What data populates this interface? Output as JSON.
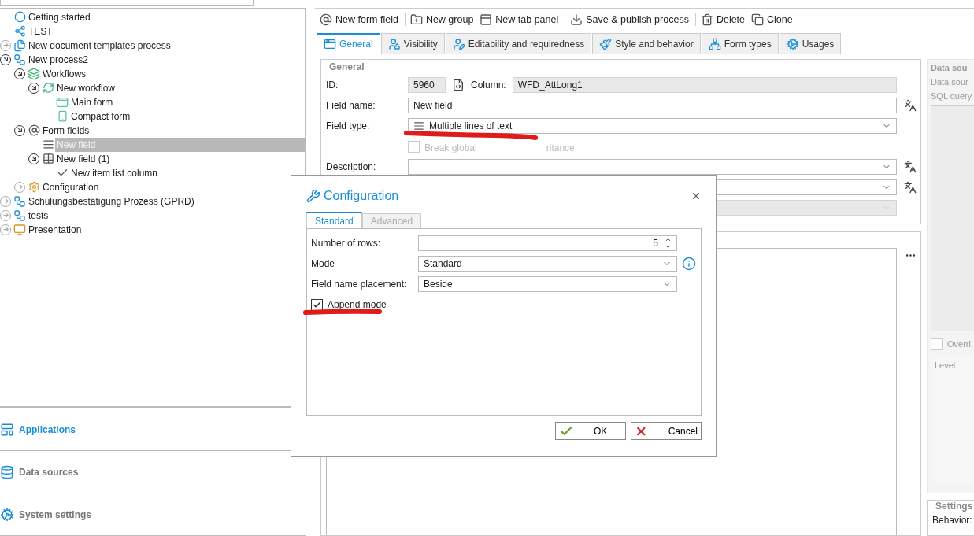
{
  "tree": [
    {
      "label": "Getting started",
      "kind": "start",
      "selected": false
    },
    {
      "label": "TEST",
      "kind": "test",
      "selected": false
    },
    {
      "label": "New document templates process",
      "kind": "doc-templates",
      "expanded": false,
      "selected": false
    },
    {
      "label": "New process2",
      "kind": "process",
      "expanded": true,
      "selected": false,
      "children": [
        {
          "label": "Workflows",
          "kind": "workflows",
          "expanded": true,
          "selected": false,
          "children": [
            {
              "label": "New workflow",
              "kind": "workflow",
              "expanded": true,
              "selected": false,
              "children": [
                {
                  "label": "Main form",
                  "kind": "form",
                  "selected": false
                },
                {
                  "label": "Compact form",
                  "kind": "compact-form",
                  "selected": false
                }
              ]
            }
          ]
        },
        {
          "label": "Form fields",
          "kind": "form-fields",
          "expanded": true,
          "selected": false,
          "children": [
            {
              "label": "New field",
              "kind": "text-field",
              "selected": true
            },
            {
              "label": "New field (1)",
              "kind": "list-field",
              "expanded": true,
              "selected": false,
              "children": [
                {
                  "label": "New item list column",
                  "kind": "column",
                  "selected": false
                }
              ]
            }
          ]
        },
        {
          "label": "Configuration",
          "kind": "config",
          "expanded": false,
          "selected": false
        }
      ]
    },
    {
      "label": "Schulungsbestätigung Prozess (GPRD)",
      "kind": "process",
      "expanded": false,
      "selected": false
    },
    {
      "label": "tests",
      "kind": "process",
      "expanded": false,
      "selected": false
    },
    {
      "label": "Presentation",
      "kind": "presentation",
      "expanded": false,
      "selected": false
    }
  ],
  "nav": [
    {
      "label": "Applications",
      "kind": "apps",
      "selected": true
    },
    {
      "label": "Data sources",
      "kind": "data",
      "selected": false
    },
    {
      "label": "System settings",
      "kind": "settings",
      "selected": false
    }
  ],
  "toolbar": [
    {
      "buttons": [
        {
          "label": "New form field",
          "kind": "field"
        }
      ]
    },
    {
      "buttons": [
        {
          "label": "New group",
          "kind": "group"
        },
        {
          "label": "New tab panel",
          "kind": "tab"
        }
      ]
    },
    {
      "buttons": [
        {
          "label": "Save & publish process",
          "kind": "save"
        }
      ]
    },
    {
      "buttons": [
        {
          "label": "Delete",
          "kind": "delete"
        },
        {
          "label": "Clone",
          "kind": "clone"
        }
      ]
    }
  ],
  "tabs": [
    {
      "label": "General",
      "kind": "general",
      "selected": true
    },
    {
      "label": "Visibility",
      "kind": "visibility",
      "selected": false
    },
    {
      "label": "Editability and requiredness",
      "kind": "edit",
      "selected": false
    },
    {
      "label": "Style and behavior",
      "kind": "style",
      "selected": false
    },
    {
      "label": "Form types",
      "kind": "types",
      "selected": false
    },
    {
      "label": "Usages",
      "kind": "usages",
      "selected": false
    }
  ],
  "general": {
    "title": "General",
    "id_label": "ID:",
    "id_value": "5960",
    "column_label": "Column:",
    "column_value": "WFD_AttLong1",
    "rows": [
      {
        "kind": "text",
        "label": "Field name:",
        "value": "New field",
        "translatable": true,
        "disabled": false
      },
      {
        "kind": "type-select",
        "label": "Field type:",
        "value": "Multiple lines of text",
        "translatable": false,
        "disabled": false
      },
      {
        "kind": "checkbox",
        "label_parts": [
          "Break global",
          "ritance"
        ],
        "checked": false,
        "disabled": true
      },
      {
        "kind": "select",
        "label": "Description:",
        "translatable": true,
        "disabled": false
      },
      {
        "kind": "select",
        "translatable": true,
        "disabled": false
      },
      {
        "kind": "select",
        "translatable": false,
        "disabled": true
      }
    ]
  },
  "data_source": {
    "title": "Data sou",
    "labels": [
      "Data sour",
      "SQL query"
    ],
    "override": {
      "label": "Overri",
      "checked": false
    },
    "level_header": "Level"
  },
  "settings": {
    "title": "Settings",
    "behavior_label": "Behavior:"
  },
  "dialog": {
    "title": "Configuration",
    "tabs": [
      {
        "label": "Standard",
        "selected": true
      },
      {
        "label": "Advanced",
        "selected": false
      }
    ],
    "rows": [
      {
        "kind": "number",
        "label": "Number of rows:",
        "value": "5"
      },
      {
        "kind": "select",
        "label": "Mode",
        "value": "Standard",
        "info": true
      },
      {
        "kind": "select",
        "label": "Field name placement:",
        "value": "Beside",
        "info": false
      }
    ],
    "append": {
      "label": "Append mode",
      "checked": true
    },
    "buttons": [
      {
        "label": "OK",
        "kind": "ok"
      },
      {
        "label": "Cancel",
        "kind": "cancel"
      }
    ]
  }
}
